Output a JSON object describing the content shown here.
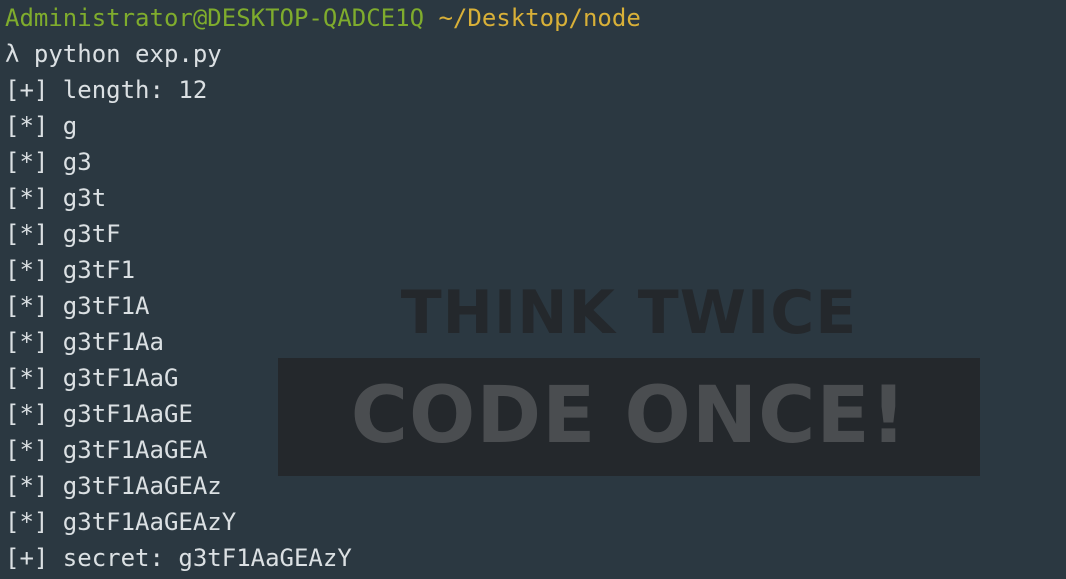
{
  "prompt": {
    "user_host": "Administrator@DESKTOP-QADCE1Q",
    "path": "~/Desktop/node"
  },
  "command": "λ python exp.py",
  "output": [
    "[+] length: 12",
    "[*] g",
    "[*] g3",
    "[*] g3t",
    "[*] g3tF",
    "[*] g3tF1",
    "[*] g3tF1A",
    "[*] g3tF1Aa",
    "[*] g3tF1AaG",
    "[*] g3tF1AaGE",
    "[*] g3tF1AaGEA",
    "[*] g3tF1AaGEAz",
    "[*] g3tF1AaGEAzY",
    "[+] secret: g3tF1AaGEAzY"
  ],
  "watermark": {
    "line1": "THINK TWICE",
    "line2": "CODE ONCE!"
  },
  "colors": {
    "background": "#2b3841",
    "text": "#dbe0e3",
    "user_host": "#7fac2d",
    "path": "#d8b038"
  }
}
